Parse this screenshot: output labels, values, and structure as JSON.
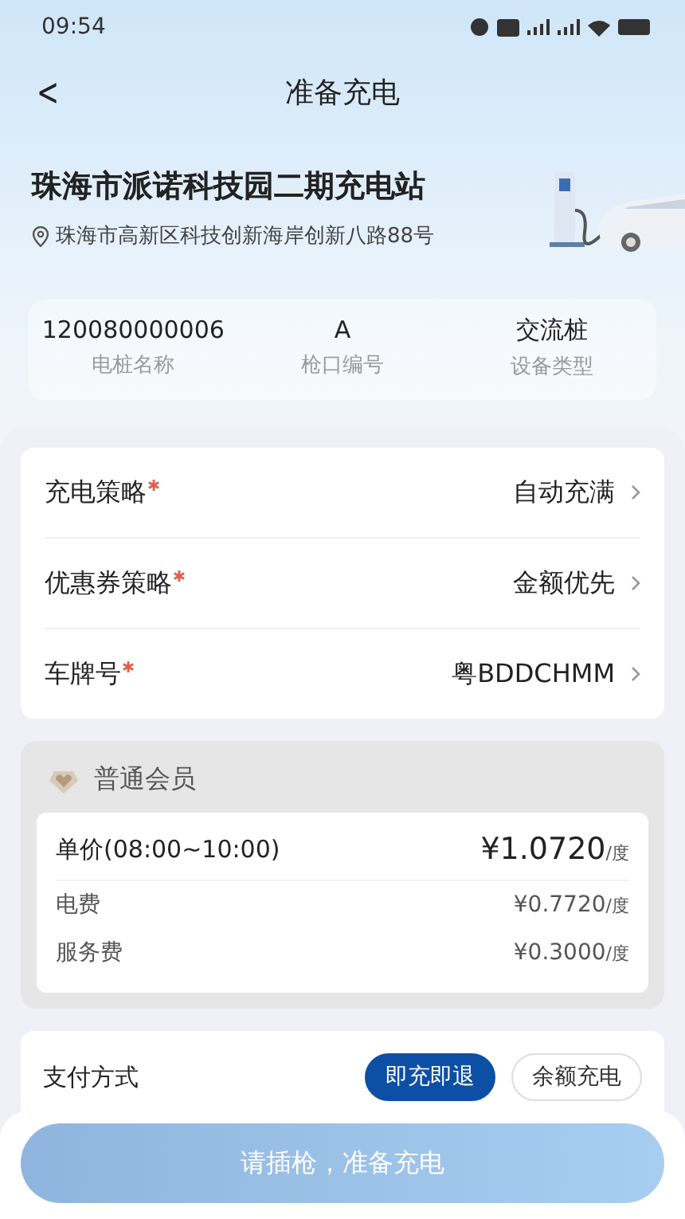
{
  "status_bar": {
    "time": "09:54"
  },
  "nav": {
    "back": "<",
    "title": "准备充电"
  },
  "station": {
    "name": "珠海市派诺科技园二期充电站",
    "address": "珠海市高新区科技创新海岸创新八路88号"
  },
  "info": [
    {
      "value": "120080000006",
      "label": "电桩名称"
    },
    {
      "value": "A",
      "label": "枪口编号"
    },
    {
      "value": "交流桩",
      "label": "设备类型"
    }
  ],
  "settings": [
    {
      "label": "充电策略",
      "required": true,
      "value": "自动充满"
    },
    {
      "label": "优惠券策略",
      "required": true,
      "value": "金额优先"
    },
    {
      "label": "车牌号",
      "required": true,
      "value": "粤BDDCHMM"
    }
  ],
  "member": {
    "level": "普通会员",
    "price": {
      "label": "单价(08:00~10:00)",
      "value": "¥1.0720",
      "unit": "/度"
    },
    "items": [
      {
        "label": "电费",
        "value": "¥0.7720",
        "unit": "/度"
      },
      {
        "label": "服务费",
        "value": "¥0.3000",
        "unit": "/度"
      }
    ]
  },
  "payment": {
    "label": "支付方式",
    "options": [
      {
        "label": "即充即退",
        "selected": true
      },
      {
        "label": "余额充电",
        "selected": false
      }
    ]
  },
  "action": {
    "label": "请插枪，准备充电",
    "disabled": true
  }
}
